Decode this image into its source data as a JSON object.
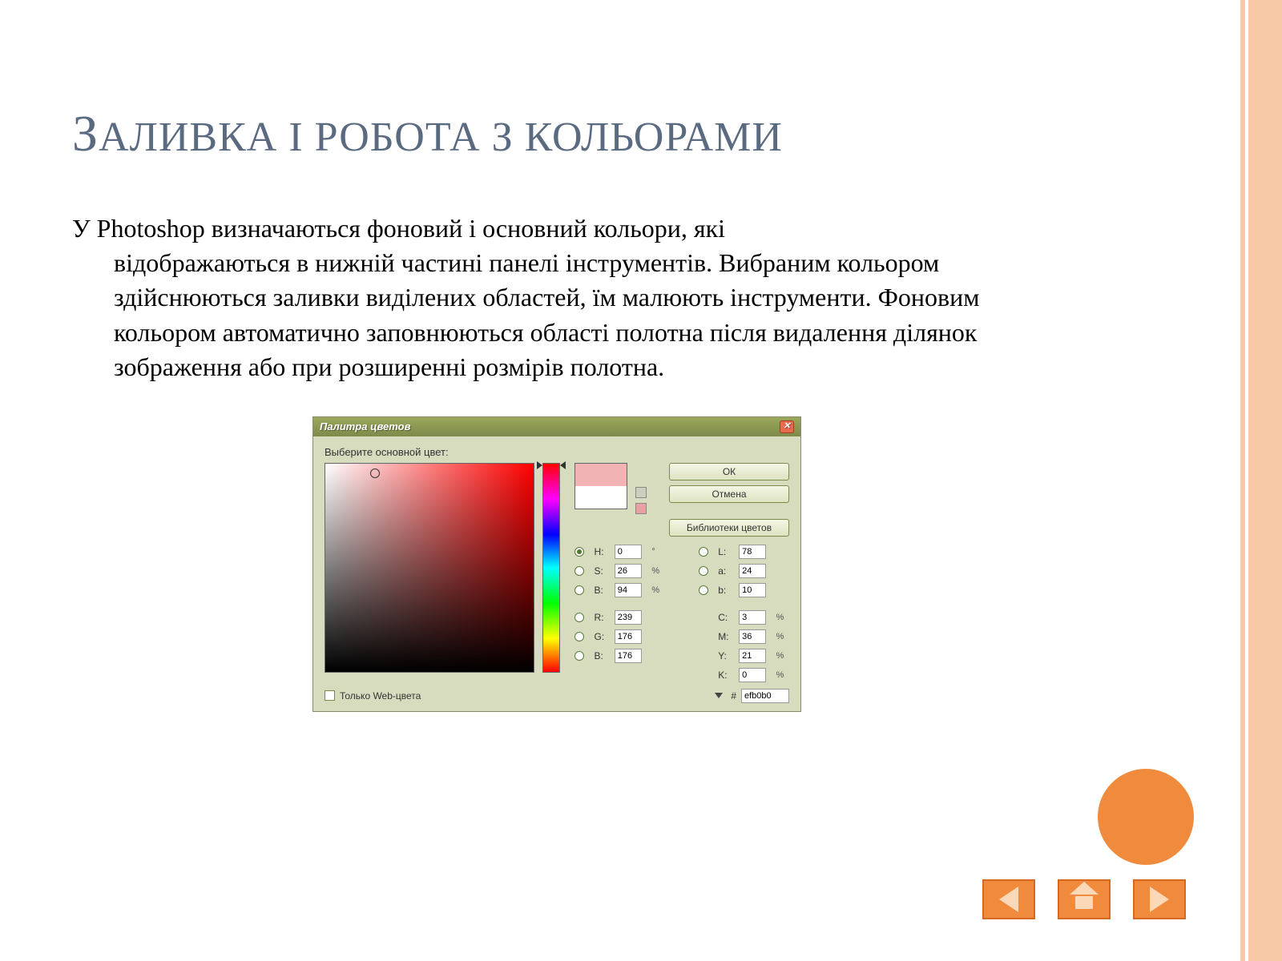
{
  "slide": {
    "title_first": "З",
    "title_rest": "АЛИВКА І РОБОТА З КОЛЬОРАМИ",
    "body_lead": "У Photoshop визначаються фоновий і основний кольори, які",
    "body_rest": "відображаються в нижній частині панелі інструментів. Вибраним кольором здійснюються заливки виділених областей, їм малюють інструменти. Фоновим кольором автоматично заповнюються області полотна після видалення ділянок зображення або при розширенні розмірів полотна."
  },
  "dialog": {
    "title": "Палитра цветов",
    "prompt": "Выберите основной цвет:",
    "buttons": {
      "ok": "ОК",
      "cancel": "Отмена",
      "libraries": "Библиотеки цветов"
    },
    "hsb": {
      "H": {
        "label": "H:",
        "value": "0",
        "unit": "°"
      },
      "S": {
        "label": "S:",
        "value": "26",
        "unit": "%"
      },
      "B": {
        "label": "B:",
        "value": "94",
        "unit": "%"
      }
    },
    "lab": {
      "L": {
        "label": "L:",
        "value": "78"
      },
      "a": {
        "label": "a:",
        "value": "24"
      },
      "b": {
        "label": "b:",
        "value": "10"
      }
    },
    "rgb": {
      "R": {
        "label": "R:",
        "value": "239"
      },
      "G": {
        "label": "G:",
        "value": "176"
      },
      "B": {
        "label": "B:",
        "value": "176"
      }
    },
    "cmyk": {
      "C": {
        "label": "C:",
        "value": "3",
        "unit": "%"
      },
      "M": {
        "label": "M:",
        "value": "36",
        "unit": "%"
      },
      "Y": {
        "label": "Y:",
        "value": "21",
        "unit": "%"
      },
      "K": {
        "label": "K:",
        "value": "0",
        "unit": "%"
      }
    },
    "hex": {
      "label": "#",
      "value": "efb0b0"
    },
    "web_only": "Только Web-цвета"
  }
}
